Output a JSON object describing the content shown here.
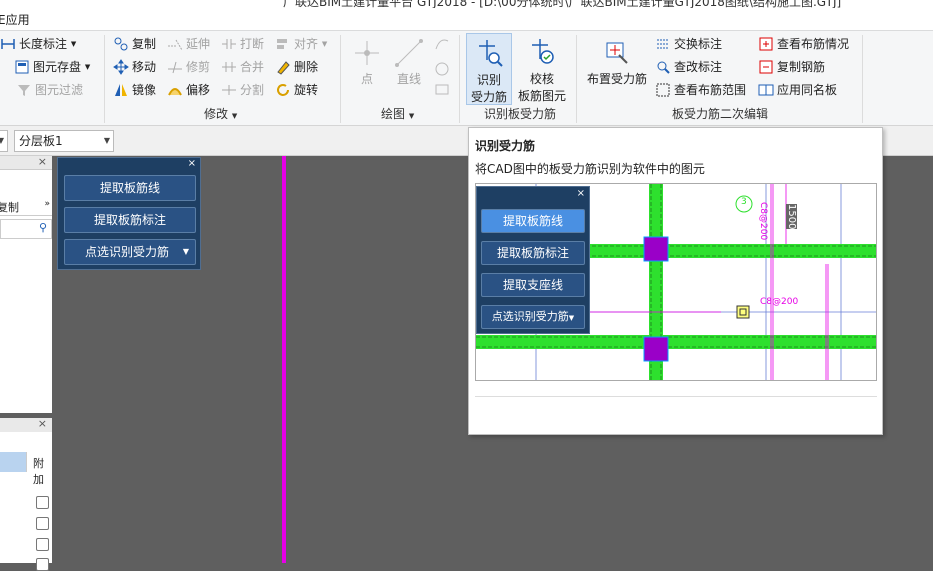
{
  "titlebar": {
    "text": "广联达BIM土建计量平台 GTJ2018 - [D:\\00分体统时\\广联达BIM土建计量GTJ2018图纸\\结构施工图.GTJ]"
  },
  "ribbon_tab": {
    "label": "E应用"
  },
  "ribbon": {
    "col1": {
      "length_label": "长度标注",
      "save_label": "图元存盘",
      "filter_label": "图元过滤"
    },
    "modify": {
      "copy": "复制",
      "move": "移动",
      "mirror": "镜像",
      "extend": "延伸",
      "trim": "修剪",
      "offset": "偏移",
      "break": "打断",
      "merge": "合并",
      "split": "分割",
      "align": "对齐",
      "delete": "删除",
      "rotate": "旋转",
      "group_label": "修改"
    },
    "draw": {
      "point": "点",
      "line": "直线",
      "group_label": "绘图"
    },
    "recognize": {
      "btn1_line1": "识别",
      "btn1_line2": "受力筋",
      "btn2_line1": "校核",
      "btn2_line2": "板筋图元",
      "group_label": "识别板受力筋"
    },
    "edit2": {
      "place": "布置受力筋",
      "swap": "交换标注",
      "check_change": "查改标注",
      "view_range": "查看布筋范围",
      "view_info": "查看布筋情况",
      "copy_rebar": "复制钢筋",
      "apply_same": "应用同名板",
      "group_label": "板受力筋二次编辑"
    }
  },
  "toolbar2": {
    "layer": "分层板1"
  },
  "left_panel": {
    "copy_label": "复制",
    "add_label": "附加"
  },
  "float_panel": {
    "btn1": "提取板筋线",
    "btn2": "提取板筋标注",
    "btn3": "点选识别受力筋"
  },
  "tooltip": {
    "title": "识别受力筋",
    "description": "将CAD图中的板受力筋识别为软件中的图元",
    "panel": {
      "btn1": "提取板筋线",
      "btn2": "提取板筋标注",
      "btn3": "提取支座线",
      "btn4": "点选识别受力筋"
    },
    "cad": {
      "circle_num": "3",
      "dim1": "1500",
      "dim2": "C8@200",
      "dim3": "C8@200"
    }
  },
  "colors": {
    "ribbon_bg": "#f5f6f7",
    "canvas_bg": "#5f5f5f",
    "panel_bg": "#1e3f63",
    "magenta": "#e600e6",
    "green": "#2ee02e"
  }
}
